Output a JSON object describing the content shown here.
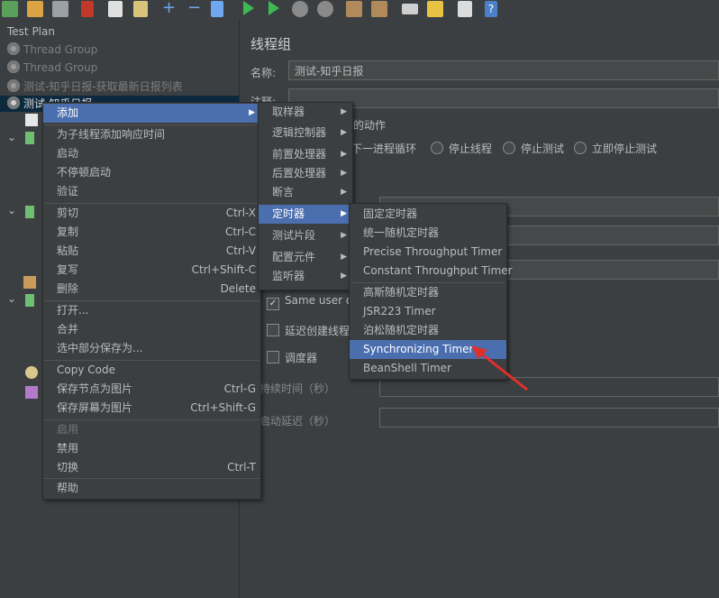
{
  "toolbar": {
    "icons": [
      "template-icon",
      "open-icon",
      "save-icon",
      "cut-icon",
      "copy-icon",
      "paste-icon",
      "expand-icon",
      "collapse-icon",
      "toggle-icon",
      "start-icon",
      "start-no-pause-icon",
      "stop-icon",
      "shutdown-icon",
      "clear-icon",
      "clear-all-icon",
      "search-icon",
      "reset-search-icon",
      "function-helper-icon",
      "help-icon"
    ]
  },
  "tree": {
    "items": [
      {
        "label": "Test Plan"
      },
      {
        "label": "Thread Group"
      },
      {
        "label": "Thread Group"
      },
      {
        "label": "测试-知乎日报-获取最新日报列表"
      },
      {
        "label": "测试-知乎日报"
      }
    ]
  },
  "panel": {
    "title": "线程组",
    "name_label": "名称:",
    "name_value": "测试-知乎日报",
    "comment_label": "注释:",
    "error_action_label": "行的动作",
    "radios": [
      "下一进程循环",
      "停止线程",
      "停止测试",
      "立即停止测试"
    ],
    "same_user": "Same user on",
    "delay_create": "延迟创建线程",
    "scheduler": "调度器",
    "duration_label": "持续时间（秒）",
    "startup_delay_label": "启动延迟（秒）"
  },
  "context_menu": {
    "items": [
      {
        "label": "添加",
        "shortcut": "",
        "submenu": true
      },
      {
        "label": "为子线程添加响应时间",
        "shortcut": ""
      },
      {
        "label": "启动",
        "shortcut": ""
      },
      {
        "label": "不停顿启动",
        "shortcut": ""
      },
      {
        "label": "验证",
        "shortcut": ""
      },
      {
        "label": "剪切",
        "shortcut": "Ctrl-X"
      },
      {
        "label": "复制",
        "shortcut": "Ctrl-C"
      },
      {
        "label": "粘贴",
        "shortcut": "Ctrl-V"
      },
      {
        "label": "复写",
        "shortcut": "Ctrl+Shift-C"
      },
      {
        "label": "删除",
        "shortcut": "Delete"
      },
      {
        "label": "打开...",
        "shortcut": ""
      },
      {
        "label": "合并",
        "shortcut": ""
      },
      {
        "label": "选中部分保存为...",
        "shortcut": ""
      },
      {
        "label": "Copy Code",
        "shortcut": ""
      },
      {
        "label": "保存节点为图片",
        "shortcut": "Ctrl-G"
      },
      {
        "label": "保存屏幕为图片",
        "shortcut": "Ctrl+Shift-G"
      },
      {
        "label": "启用",
        "shortcut": ""
      },
      {
        "label": "禁用",
        "shortcut": ""
      },
      {
        "label": "切换",
        "shortcut": "Ctrl-T"
      },
      {
        "label": "帮助",
        "shortcut": ""
      }
    ]
  },
  "add_menu": {
    "items": [
      "取样器",
      "逻辑控制器",
      "前置处理器",
      "后置处理器",
      "断言",
      "定时器",
      "测试片段",
      "配置元件",
      "监听器"
    ]
  },
  "timer_menu": {
    "items": [
      "固定定时器",
      "统一随机定时器",
      "Precise Throughput Timer",
      "Constant Throughput Timer",
      "高斯随机定时器",
      "JSR223 Timer",
      "泊松随机定时器",
      "Synchronizing Timer",
      "BeanShell Timer"
    ]
  },
  "colors": {
    "background": "#3c3f41",
    "selection": "#4b6eaf",
    "arrow": "#e0302a"
  }
}
